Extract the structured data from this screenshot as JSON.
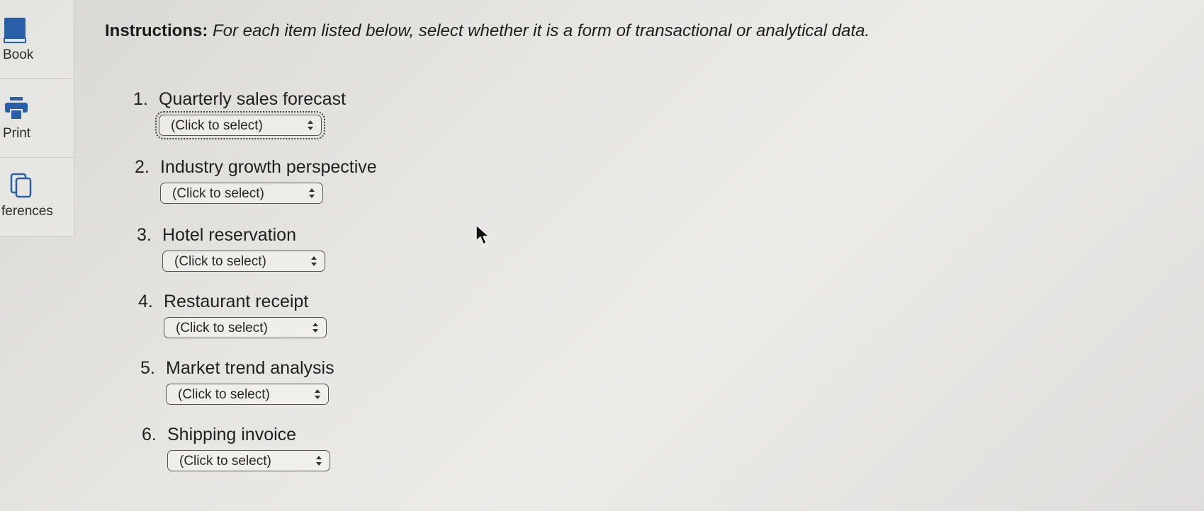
{
  "sidebar": {
    "items": [
      {
        "label": "Book",
        "icon": "book-icon"
      },
      {
        "label": "Print",
        "icon": "printer-icon"
      },
      {
        "label": "ferences",
        "icon": "references-icon"
      }
    ]
  },
  "instructions": {
    "lead": "Instructions:",
    "body": "For each item listed below, select whether it is a form of transactional or analytical data."
  },
  "questions": [
    {
      "number": "1.",
      "text": "Quarterly sales forecast",
      "select_value": "(Click to select)"
    },
    {
      "number": "2.",
      "text": "Industry growth perspective",
      "select_value": "(Click to select)"
    },
    {
      "number": "3.",
      "text": "Hotel reservation",
      "select_value": "(Click to select)"
    },
    {
      "number": "4.",
      "text": "Restaurant receipt",
      "select_value": "(Click to select)"
    },
    {
      "number": "5.",
      "text": "Market trend analysis",
      "select_value": "(Click to select)"
    },
    {
      "number": "6.",
      "text": "Shipping invoice",
      "select_value": "(Click to select)"
    }
  ],
  "colors": {
    "background": "#e6e5e2",
    "book_icon": "#2a5fa8",
    "printer_icon": "#2a5fa8",
    "text": "#1f1f1f"
  }
}
